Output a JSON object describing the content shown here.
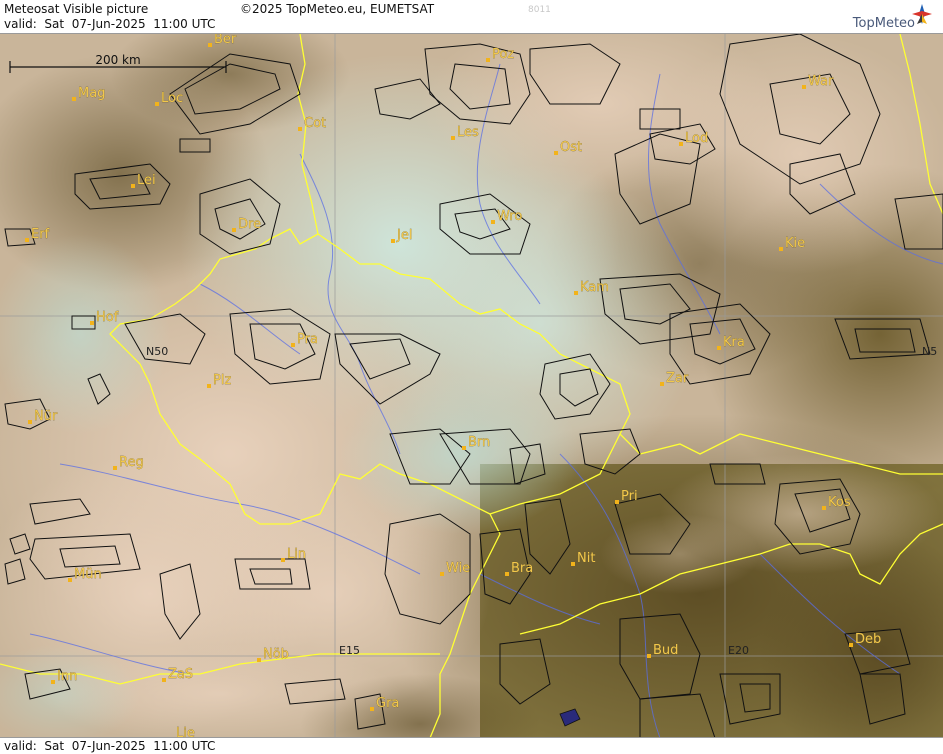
{
  "header": {
    "title": "Meteosat Visible picture",
    "copyright": "©2025 TopMeteo.eu, EUMETSAT",
    "frame_id": "8011",
    "valid": "valid:  Sat  07-Jun-2025  11:00 UTC"
  },
  "logo": {
    "text": "TopMeteo",
    "colors": [
      "#d9342b",
      "#1f5fb4",
      "#f2b31b",
      "#3a3a3a"
    ]
  },
  "footer": {
    "valid": "valid:  Sat  07-Jun-2025  11:00 UTC"
  },
  "scale_bar": {
    "label": "200 km"
  },
  "colors": {
    "city_dot": "#f2b31b",
    "city_label": "#f2c84b",
    "border": "#ffff33",
    "river": "#5a6ee6",
    "outline": "#111111"
  },
  "coordinate_labels": [
    "N50",
    "E15",
    "E20",
    "N5"
  ],
  "cities": [
    {
      "name": "Ber"
    },
    {
      "name": "Poz"
    },
    {
      "name": "War"
    },
    {
      "name": "Mag"
    },
    {
      "name": "Loc"
    },
    {
      "name": "Cot"
    },
    {
      "name": "Les"
    },
    {
      "name": "Ost"
    },
    {
      "name": "Lod"
    },
    {
      "name": "Lei"
    },
    {
      "name": "Dre"
    },
    {
      "name": "Wro"
    },
    {
      "name": "Erf"
    },
    {
      "name": "Jel"
    },
    {
      "name": "Kie"
    },
    {
      "name": "Kam"
    },
    {
      "name": "Hof"
    },
    {
      "name": "Pra"
    },
    {
      "name": "Kra"
    },
    {
      "name": "Plz"
    },
    {
      "name": "Zar"
    },
    {
      "name": "Nür"
    },
    {
      "name": "Brn"
    },
    {
      "name": "Reg"
    },
    {
      "name": "Pri"
    },
    {
      "name": "Kos"
    },
    {
      "name": "Lin"
    },
    {
      "name": "Nit"
    },
    {
      "name": "Mün"
    },
    {
      "name": "Wie"
    },
    {
      "name": "Bra"
    },
    {
      "name": "Nöb"
    },
    {
      "name": "Bud"
    },
    {
      "name": "Deb"
    },
    {
      "name": "Inn"
    },
    {
      "name": "ZaS"
    },
    {
      "name": "Gra"
    },
    {
      "name": "Lie"
    }
  ]
}
